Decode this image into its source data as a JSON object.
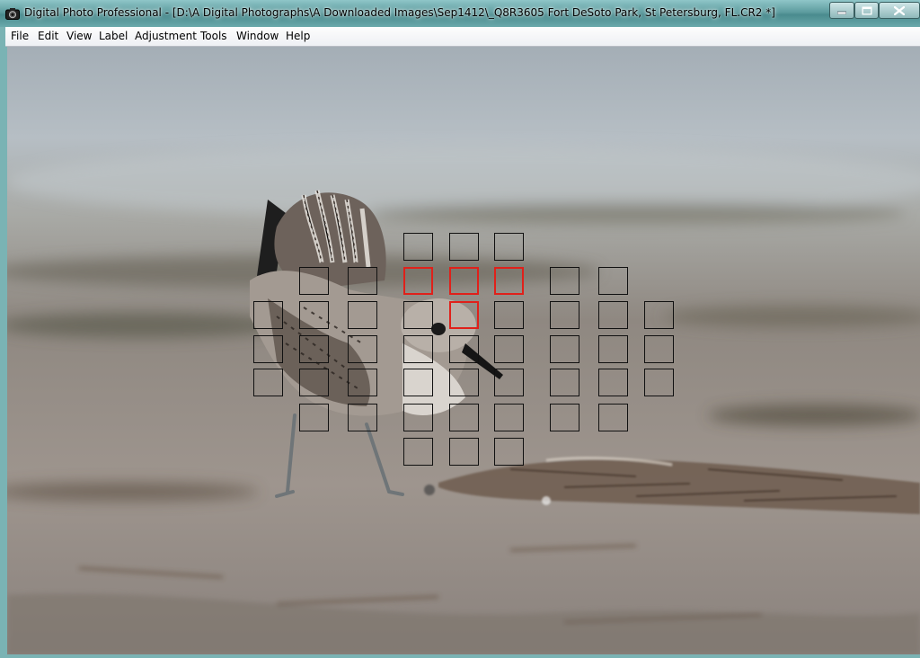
{
  "window": {
    "title": "Digital Photo Professional - [D:\\A Digital Photographs\\A Downloaded Images\\Sep1412\\_Q8R3605  Fort DeSoto Park, St Petersburg, FL.CR2 *]",
    "icon": "camera-icon"
  },
  "caption_buttons": [
    "minimize-icon",
    "maximize-icon",
    "close-icon"
  ],
  "menu": {
    "file": "File",
    "edit": "Edit",
    "view": "View",
    "label": "Label",
    "adjustment": "Adjustment",
    "tools": "Tools",
    "window": "Window",
    "help": "Help"
  },
  "af_points": {
    "columns": 9,
    "rows": 7,
    "active_color": "#e0201a",
    "inactive_color": "#111111",
    "active": [
      [
        3,
        1
      ],
      [
        4,
        1
      ],
      [
        5,
        1
      ],
      [
        4,
        2
      ]
    ],
    "layout": [
      [
        0,
        0,
        0,
        1,
        1,
        1,
        0,
        0,
        0
      ],
      [
        0,
        1,
        1,
        1,
        1,
        1,
        1,
        1,
        0
      ],
      [
        1,
        1,
        1,
        1,
        1,
        1,
        1,
        1,
        1
      ],
      [
        1,
        1,
        1,
        1,
        1,
        1,
        1,
        1,
        1
      ],
      [
        1,
        1,
        1,
        1,
        1,
        1,
        1,
        1,
        1
      ],
      [
        0,
        1,
        1,
        1,
        1,
        1,
        1,
        1,
        0
      ],
      [
        0,
        0,
        0,
        1,
        1,
        1,
        0,
        0,
        0
      ]
    ]
  }
}
